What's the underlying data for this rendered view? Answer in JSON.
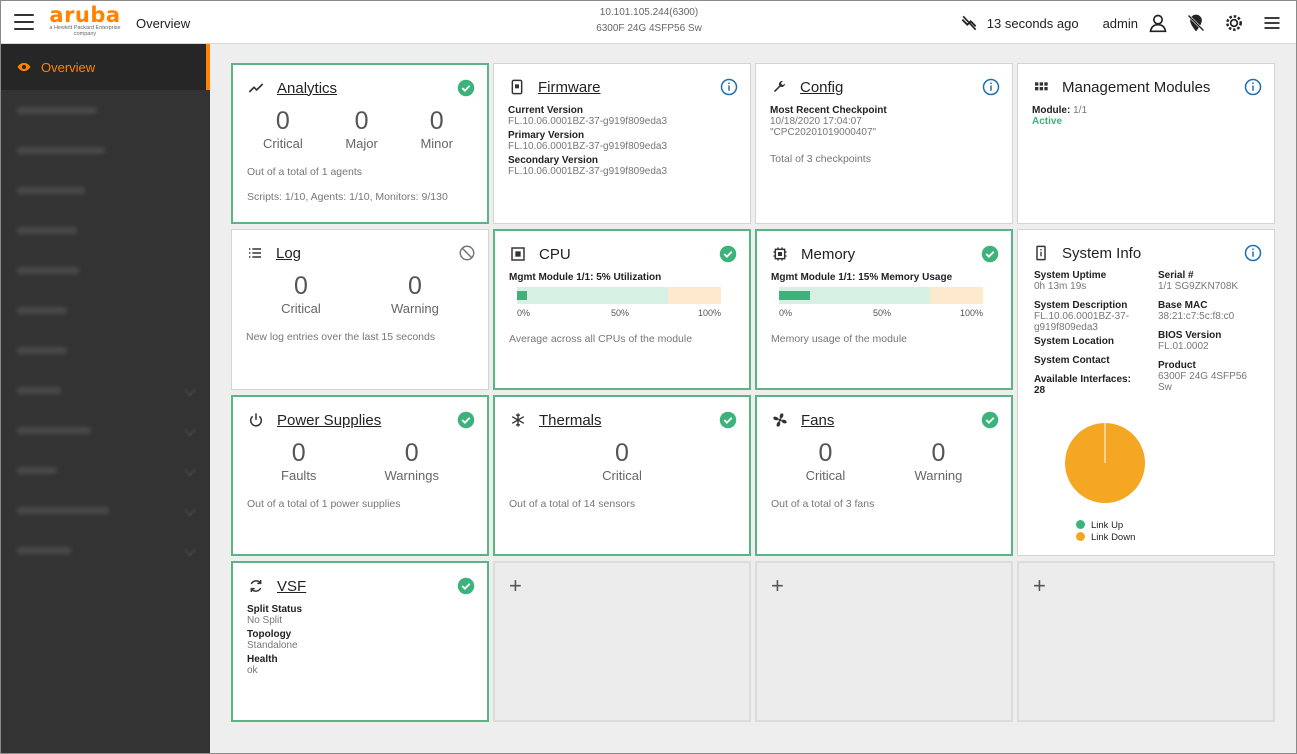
{
  "header": {
    "logo": "aruba",
    "logo_tag": "a Hewlett Packard Enterprise company",
    "page_title": "Overview",
    "device_ip": "10.101.105.244(6300)",
    "device_model": "6300F 24G 4SFP56 Sw",
    "last_update": "13 seconds ago",
    "user": "admin"
  },
  "sidebar": {
    "active_item": "Overview"
  },
  "colors": {
    "accent": "#ff8300",
    "ok": "#3bb37a",
    "info": "#1f6fb2",
    "warning_bg": "#fde9cd",
    "link_down": "#f5a623"
  },
  "cards": {
    "analytics": {
      "title": "Analytics",
      "stats": [
        {
          "value": "0",
          "label": "Critical"
        },
        {
          "value": "0",
          "label": "Major"
        },
        {
          "value": "0",
          "label": "Minor"
        }
      ],
      "note1": "Out of a total of 1 agents",
      "note2": "Scripts: 1/10, Agents: 1/10, Monitors: 9/130"
    },
    "firmware": {
      "title": "Firmware",
      "current_label": "Current Version",
      "current_value": "FL.10.06.0001BZ-37-g919f809eda3",
      "primary_label": "Primary Version",
      "primary_value": "FL.10.06.0001BZ-37-g919f809eda3",
      "secondary_label": "Secondary Version",
      "secondary_value": "FL.10.06.0001BZ-37-g919f809eda3"
    },
    "config": {
      "title": "Config",
      "checkpoint_label": "Most Recent Checkpoint",
      "checkpoint_date": "10/18/2020 17:04:07",
      "checkpoint_name": "\"CPC20201019000407\"",
      "note": "Total of 3 checkpoints"
    },
    "modules": {
      "title": "Management Modules",
      "module_label": "Module:",
      "module_value": "1/1",
      "module_status": "Active"
    },
    "log": {
      "title": "Log",
      "stats": [
        {
          "value": "0",
          "label": "Critical"
        },
        {
          "value": "0",
          "label": "Warning"
        }
      ],
      "note": "New log entries over the last 15 seconds"
    },
    "cpu": {
      "title": "CPU",
      "gauge_title": "Mgmt Module 1/1: 5% Utilization",
      "utilization_pct": 5,
      "ticks": [
        "0%",
        "50%",
        "100%"
      ],
      "note": "Average across all CPUs of the module"
    },
    "memory": {
      "title": "Memory",
      "gauge_title": "Mgmt Module 1/1: 15% Memory Usage",
      "usage_pct": 15,
      "ticks": [
        "0%",
        "50%",
        "100%"
      ],
      "note": "Memory usage of the module"
    },
    "sysinfo": {
      "title": "System Info",
      "uptime_label": "System Uptime",
      "uptime_value": "0h 13m 19s",
      "serial_label": "Serial #",
      "serial_value": "1/1 SG9ZKN708K",
      "desc_label": "System Description",
      "desc_value": "FL.10.06.0001BZ-37-g919f809eda3",
      "mac_label": "Base MAC",
      "mac_value": "38:21:c7:5c:f8:c0",
      "bios_label": "BIOS Version",
      "bios_value": "FL.01.0002",
      "location_label": "System Location",
      "contact_label": "System Contact",
      "product_label": "Product",
      "product_value": "6300F 24G 4SFP56 Sw",
      "interfaces_label": "Available Interfaces:",
      "interfaces_value": "28",
      "legend_up": "Link Up",
      "legend_down": "Link Down",
      "link_up_fraction": 0.0,
      "link_down_fraction": 1.0
    },
    "power": {
      "title": "Power Supplies",
      "stats": [
        {
          "value": "0",
          "label": "Faults"
        },
        {
          "value": "0",
          "label": "Warnings"
        }
      ],
      "note": "Out of a total of 1 power supplies"
    },
    "thermals": {
      "title": "Thermals",
      "stats": [
        {
          "value": "0",
          "label": "Critical"
        }
      ],
      "note": "Out of a total of 14 sensors"
    },
    "fans": {
      "title": "Fans",
      "stats": [
        {
          "value": "0",
          "label": "Critical"
        },
        {
          "value": "0",
          "label": "Warning"
        }
      ],
      "note": "Out of a total of 3 fans"
    },
    "vsf": {
      "title": "VSF",
      "split_label": "Split Status",
      "split_value": "No Split",
      "topology_label": "Topology",
      "topology_value": "Standalone",
      "health_label": "Health",
      "health_value": "ok"
    },
    "add_label": "+"
  }
}
